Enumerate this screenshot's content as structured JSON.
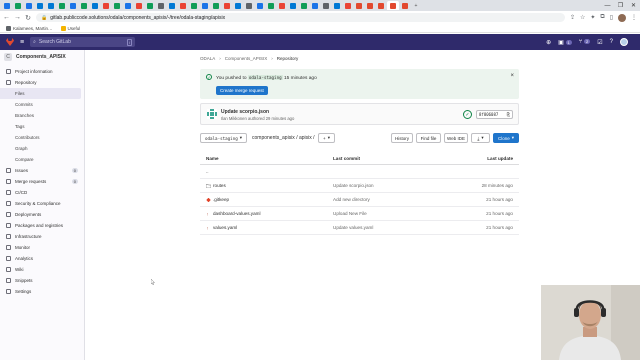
{
  "browser": {
    "url": "gitlab.publiccode.solutions/odala/components_apisix/-/tree/odala-staging/apisix",
    "bookmarks": [
      "Kalamees, Martin…",
      "Useful"
    ],
    "window_controls": [
      "—",
      "❐",
      "✕"
    ]
  },
  "topbar": {
    "search_placeholder": "Search GitLab",
    "search_shortcut": "/",
    "counts": [
      "1",
      "2"
    ]
  },
  "sidebar": {
    "project_initial": "C",
    "project_name": "Components_APISIX",
    "items": [
      {
        "label": "Project information",
        "icon": "info-icon"
      },
      {
        "label": "Repository",
        "icon": "doc-icon"
      },
      {
        "label": "Files",
        "sub": true,
        "selected": true
      },
      {
        "label": "Commits",
        "sub": true
      },
      {
        "label": "Branches",
        "sub": true
      },
      {
        "label": "Tags",
        "sub": true
      },
      {
        "label": "Contributors",
        "sub": true
      },
      {
        "label": "Graph",
        "sub": true
      },
      {
        "label": "Compare",
        "sub": true
      },
      {
        "label": "Issues",
        "icon": "issues-icon",
        "count": "0"
      },
      {
        "label": "Merge requests",
        "icon": "merge-request-icon",
        "count": "0"
      },
      {
        "label": "CI/CD",
        "icon": "rocket-icon"
      },
      {
        "label": "Security & Compliance",
        "icon": "shield-icon"
      },
      {
        "label": "Deployments",
        "icon": "deployments-icon"
      },
      {
        "label": "Packages and registries",
        "icon": "package-icon"
      },
      {
        "label": "Infrastructure",
        "icon": "cloud-icon"
      },
      {
        "label": "Monitor",
        "icon": "monitor-icon"
      },
      {
        "label": "Analytics",
        "icon": "chart-icon"
      },
      {
        "label": "Wiki",
        "icon": "book-icon"
      },
      {
        "label": "Snippets",
        "icon": "snippet-icon"
      },
      {
        "label": "Settings",
        "icon": "gear-icon"
      }
    ]
  },
  "breadcrumb": [
    "ODALA",
    "Components_APISIX",
    "Repository"
  ],
  "alert": {
    "prefix": "You pushed to",
    "branch": "odala-staging",
    "suffix": "15 minutes ago",
    "button": "Create merge request",
    "close": "×"
  },
  "commit": {
    "title": "Update scorpio.json",
    "meta": "Ilan Mikkonen authored 29 minutes ago",
    "sha": "8f806087",
    "copy_icon": "⎘",
    "pipeline_icon": "✓"
  },
  "toolbar": {
    "branch": "odala-staging",
    "path": "components_apisix / apisix /",
    "add": "+",
    "history": "History",
    "find_file": "Find file",
    "web_ide": "Web IDE",
    "download": "⤓",
    "clone": "Clone"
  },
  "table": {
    "headers": {
      "name": "Name",
      "last_commit": "Last commit",
      "last_update": "Last update"
    },
    "rows": [
      {
        "name": "..",
        "commit": "",
        "update": "",
        "type": "parent"
      },
      {
        "name": "routes",
        "commit": "Update scorpio.json",
        "update": "28 minutes ago",
        "type": "folder"
      },
      {
        "name": ".gitkeep",
        "commit": "Add new directory",
        "update": "21 hours ago",
        "type": "gitkeep"
      },
      {
        "name": "dashboard-values.yaml",
        "commit": "Upload New File",
        "update": "21 hours ago",
        "type": "yaml"
      },
      {
        "name": "values.yaml",
        "commit": "Update values.yaml",
        "update": "21 hours ago",
        "type": "yaml"
      }
    ]
  },
  "colors": {
    "gitlab_nav": "#2f2a6b",
    "primary_button": "#1f75cb",
    "success": "#108548",
    "alert_bg": "#ecf4ee"
  }
}
